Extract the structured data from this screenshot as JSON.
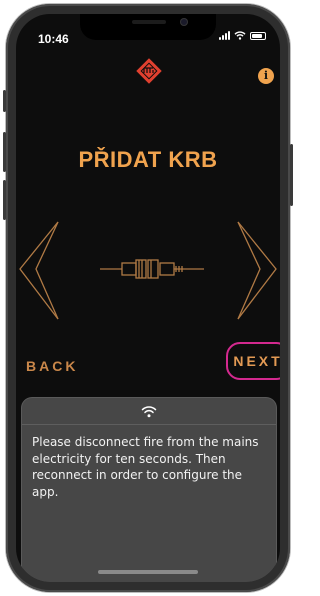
{
  "status_bar": {
    "time": "10:46"
  },
  "header": {
    "brand_logo": "dru-logo",
    "info_label": "i"
  },
  "main": {
    "title": "PŘIDAT KRB"
  },
  "illustration": {
    "icon": "fire-connector-icon"
  },
  "nav": {
    "back_label": "BACK",
    "next_label": "NEXT"
  },
  "notice": {
    "icon": "wifi-icon",
    "message": "Please disconnect fire from the mains electricity for ten seconds. Then reconnect in order to configure the app."
  },
  "colors": {
    "accent": "#f0a34e",
    "highlight": "#d4298f",
    "logo": "#e0402f"
  }
}
